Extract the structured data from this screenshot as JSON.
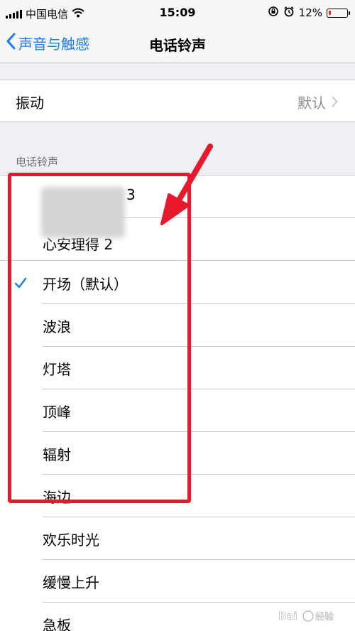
{
  "status_bar": {
    "carrier": "中国电信",
    "time": "15:09",
    "battery_percent": "12%",
    "battery_level": 0.12,
    "icons": [
      "signal-icon",
      "wifi-icon",
      "rotation-lock-icon",
      "alarm-icon",
      "battery-icon"
    ]
  },
  "nav": {
    "back_label": "声音与触感",
    "title": "电话铃声"
  },
  "vibration": {
    "label": "振动",
    "value": "默认"
  },
  "section_header": "电话铃声",
  "ringtones": [
    {
      "label": "3",
      "selected": false,
      "obscured": true
    },
    {
      "label": "心安理得 2",
      "selected": false,
      "obscured": true
    },
    {
      "label": "开场（默认）",
      "selected": true,
      "obscured": false
    },
    {
      "label": "波浪",
      "selected": false,
      "obscured": false
    },
    {
      "label": "灯塔",
      "selected": false,
      "obscured": false
    },
    {
      "label": "顶峰",
      "selected": false,
      "obscured": false
    },
    {
      "label": "辐射",
      "selected": false,
      "obscured": false
    },
    {
      "label": "海边",
      "selected": false,
      "obscured": false
    },
    {
      "label": "欢乐时光",
      "selected": false,
      "obscured": false
    },
    {
      "label": "缓慢上升",
      "selected": false,
      "obscured": false
    },
    {
      "label": "急板",
      "selected": false,
      "obscured": false
    }
  ],
  "colors": {
    "accent": "#1a7cf5",
    "annotation": "#e8192c",
    "battery_low": "#e8261f"
  }
}
